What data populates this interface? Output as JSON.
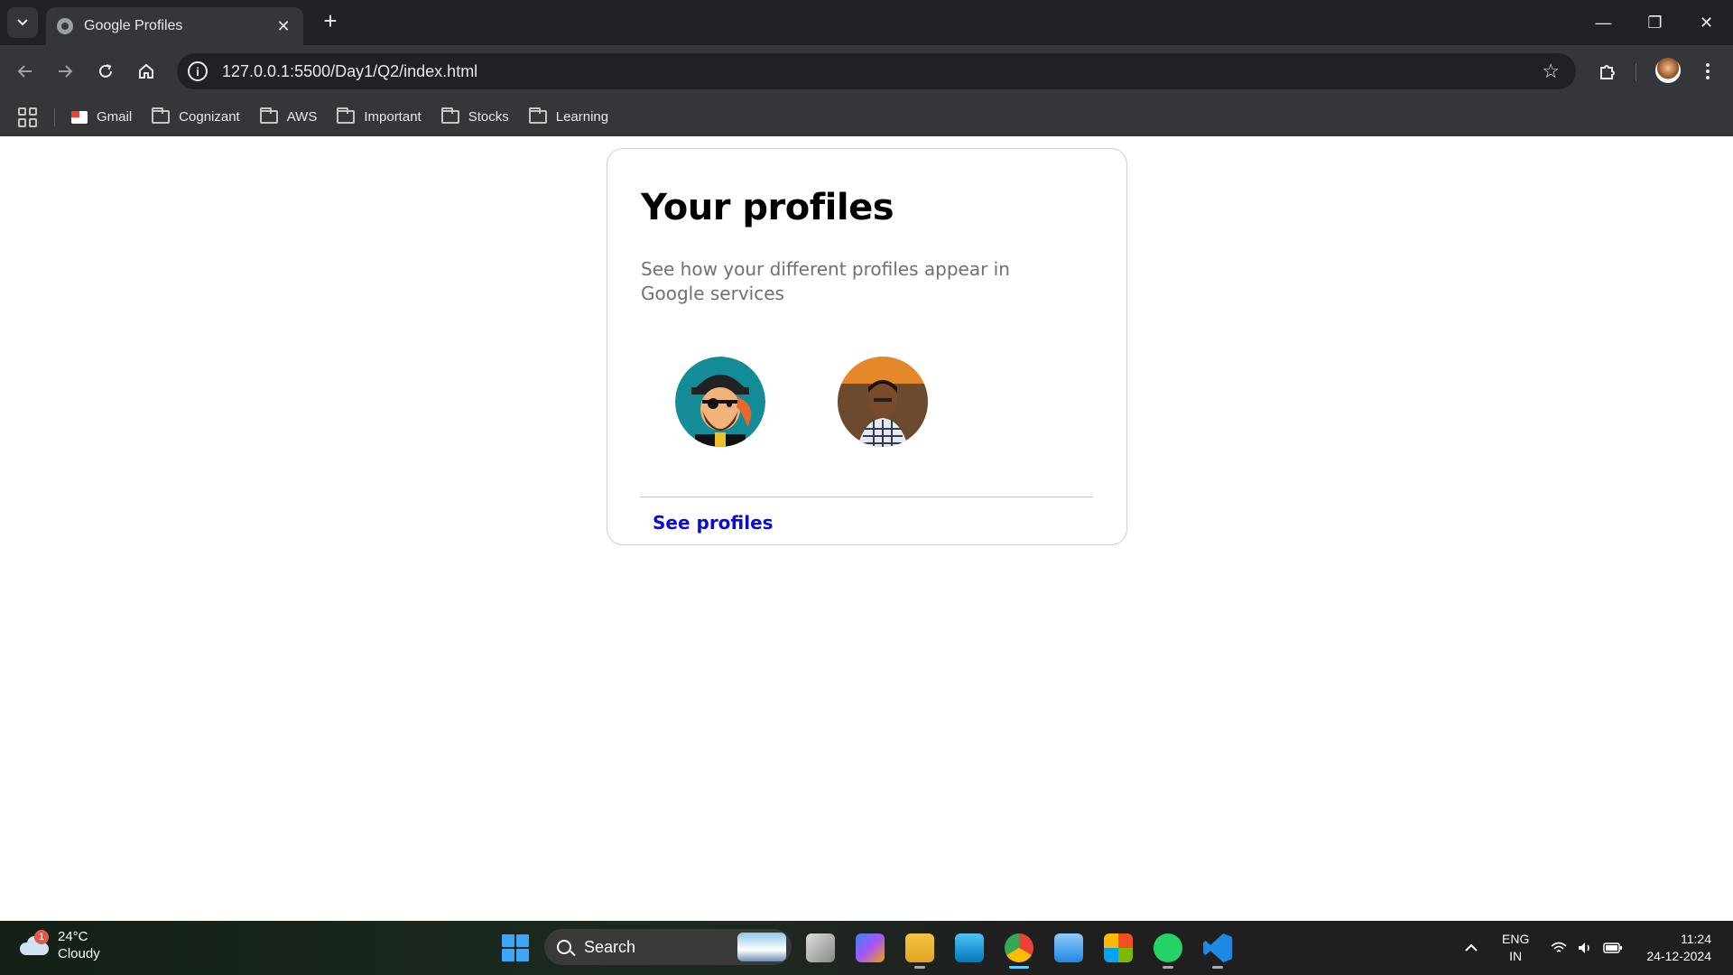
{
  "browser": {
    "tab_title": "Google Profiles",
    "url": "127.0.0.1:5500/Day1/Q2/index.html",
    "bookmarks": [
      {
        "label": "Gmail",
        "icon": "gmail-icon"
      },
      {
        "label": "Cognizant",
        "icon": "folder-icon"
      },
      {
        "label": "AWS",
        "icon": "folder-icon"
      },
      {
        "label": "Important",
        "icon": "folder-icon"
      },
      {
        "label": "Stocks",
        "icon": "folder-icon"
      },
      {
        "label": "Learning",
        "icon": "folder-icon"
      }
    ]
  },
  "page": {
    "title": "Your profiles",
    "description": "See how your different profiles appear in Google services",
    "profiles": [
      {
        "avatar": "pirate-avatar"
      },
      {
        "avatar": "photo-avatar"
      }
    ],
    "see_profiles_label": "See profiles",
    "link_color": "#0a0ad9"
  },
  "taskbar": {
    "weather_temp": "24°C",
    "weather_text": "Cloudy",
    "weather_badge": "1",
    "search_label": "Search",
    "lang_top": "ENG",
    "lang_bottom": "IN",
    "time": "11:24",
    "date": "24-12-2024"
  }
}
